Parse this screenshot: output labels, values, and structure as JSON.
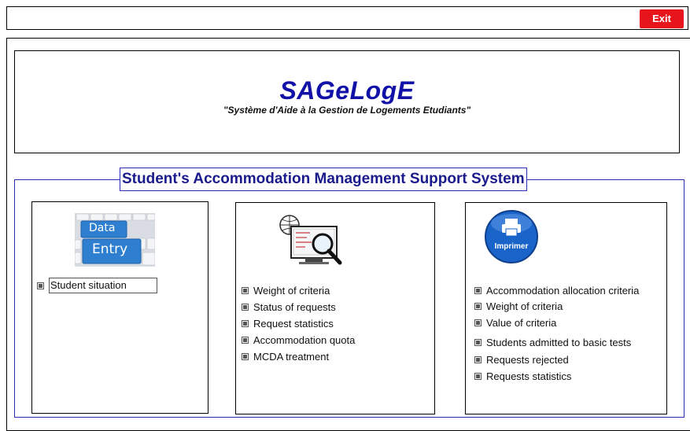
{
  "topbar": {
    "exit_label": "Exit"
  },
  "banner": {
    "app_name": "SAGeLogE",
    "subtitle": "\"Système d'Aide à la Gestion de Logements Etudiants\""
  },
  "group_title": "Student's Accommodation Management Support System",
  "entry_panel": {
    "image_keys": [
      "Data",
      "Entry"
    ],
    "items": [
      "Student situation"
    ]
  },
  "treatment_panel": {
    "items": [
      "Weight of criteria",
      "Status of requests",
      "Request statistics",
      "Accommodation quota",
      "MCDA treatment"
    ]
  },
  "print_panel": {
    "button_label": "Imprimer",
    "items": [
      "Accommodation allocation criteria",
      "Weight of criteria",
      "Value of criteria",
      "Students admitted to basic tests",
      "Requests rejected",
      "Requests statistics"
    ]
  },
  "colors": {
    "exit": "#e8141b",
    "title_blue": "#1111a8",
    "group_border": "#2a2ab8",
    "print_button": "#1a63c9"
  },
  "icons": {
    "entry_image": "data-entry-keyboard-icon",
    "treatment_image": "monitor-magnifier-icon",
    "print_button": "printer-icon"
  }
}
